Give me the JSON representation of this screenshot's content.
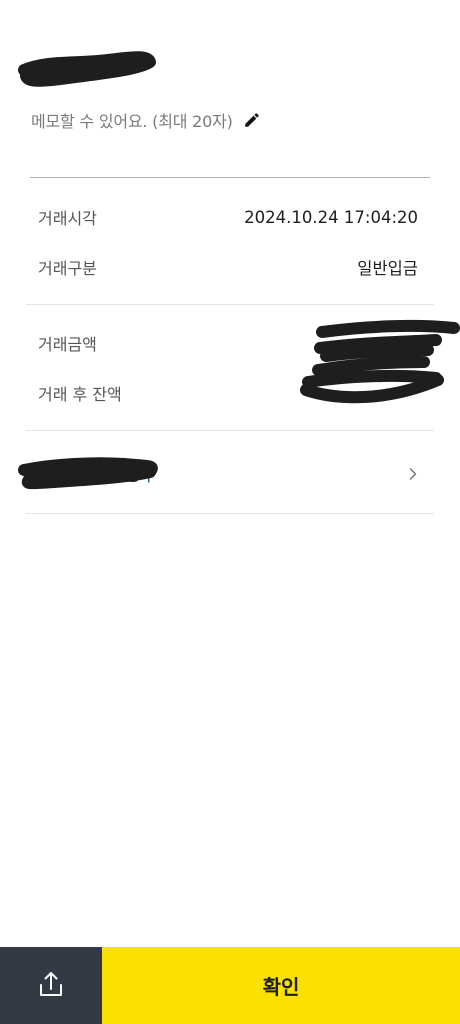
{
  "memo": {
    "placeholder": "메모할 수 있어요. (최대 20자)",
    "edit_icon": "pencil-icon"
  },
  "transaction": {
    "time_label": "거래시각",
    "time_value": "2024.10.24 17:04:20",
    "type_label": "거래구분",
    "type_value": "일반입금",
    "amount_label": "거래금액",
    "balance_label": "거래 후 잔액"
  },
  "link": {
    "visible_suffix": "기",
    "chevron_icon": "chevron-right-icon"
  },
  "bottom_bar": {
    "share_icon": "share-icon",
    "confirm_label": "확인"
  },
  "colors": {
    "confirm_bg": "#fae100",
    "share_bg": "#343a43",
    "link": "#1d5c8c"
  }
}
